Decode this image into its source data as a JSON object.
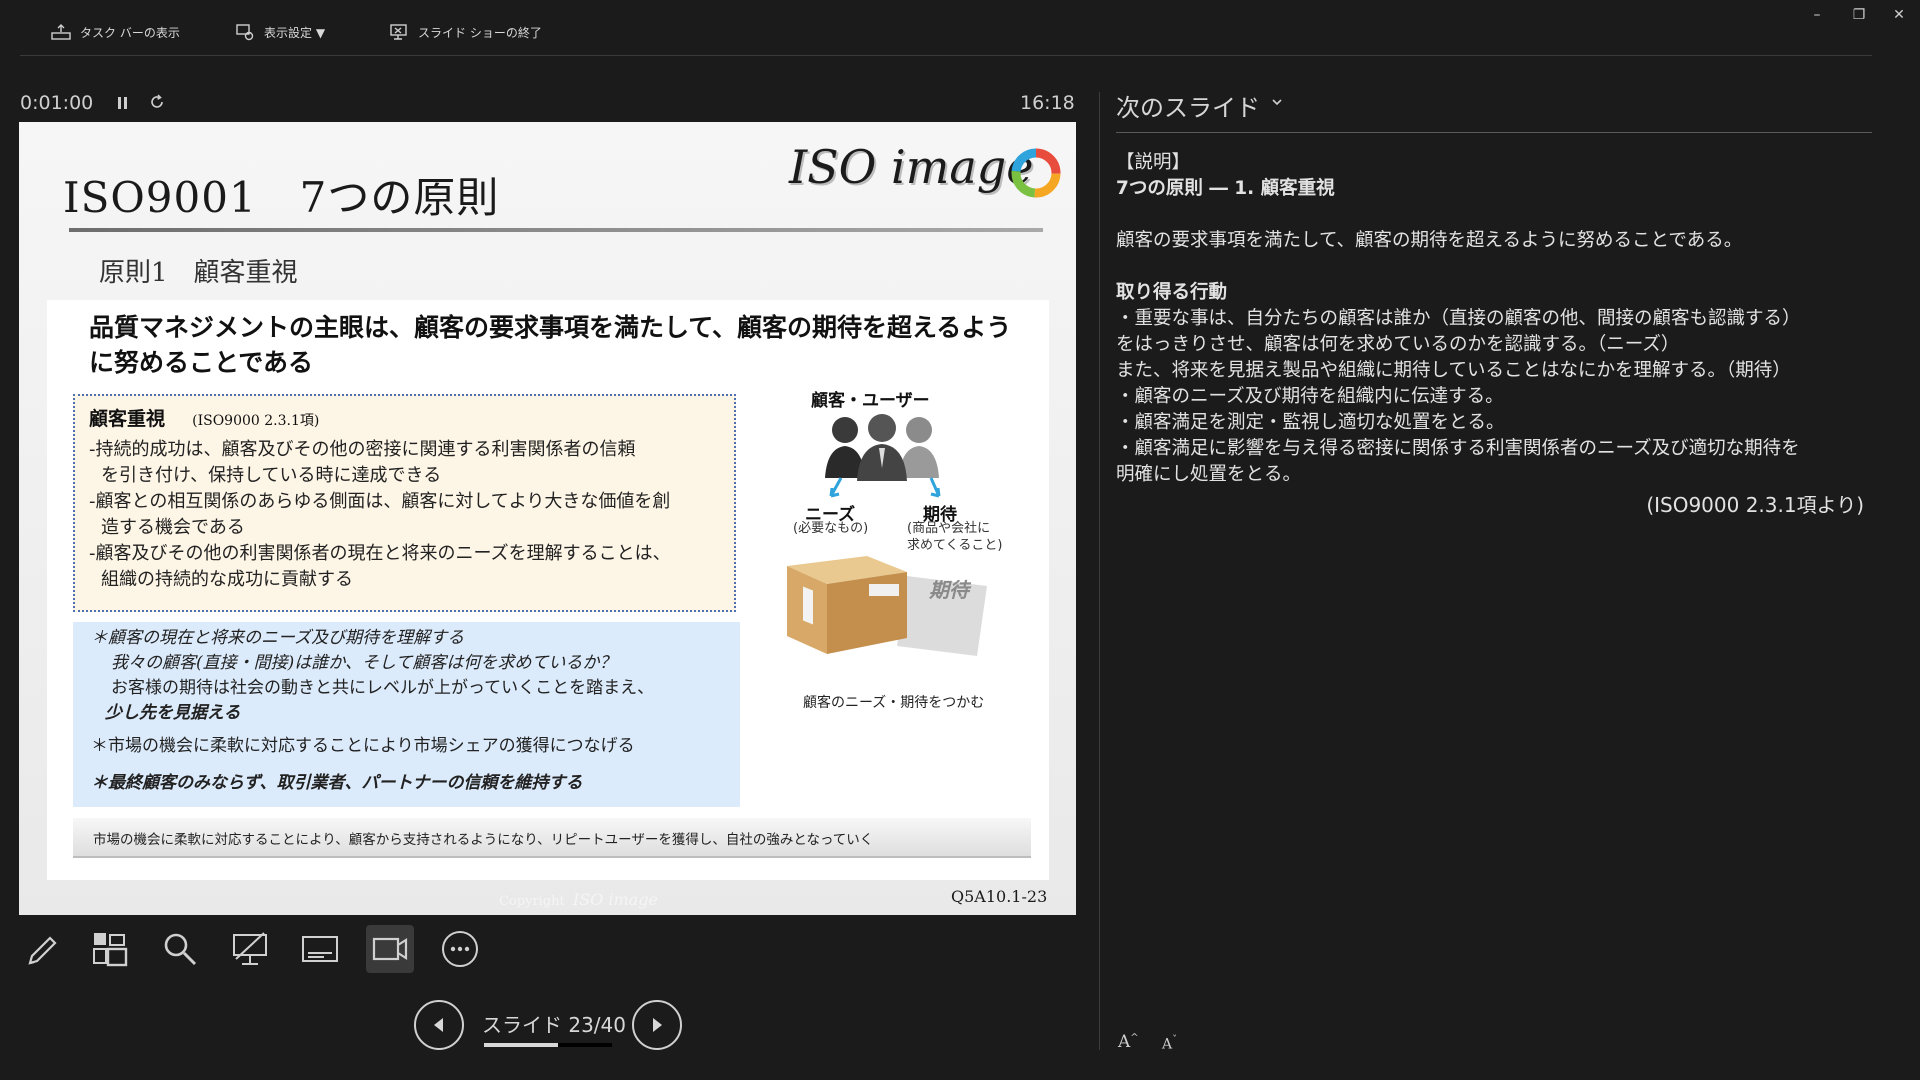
{
  "topbar": {
    "taskbar_label": "タスク バーの表示",
    "display_settings_label": "表示設定 ▼",
    "end_show_label": "スライド ショーの終了"
  },
  "presenter": {
    "timer": "0:01:00",
    "clock": "16:18"
  },
  "slide": {
    "title": "ISO9001　7つの原則",
    "logo_text": "ISO image",
    "subtitle": "原則1　顧客重視",
    "headline": "品質マネジメントの主眼は、顧客の要求事項を満たして、顧客の期待を超えるように努めることである",
    "yellow_box": {
      "title": "顧客重視",
      "ref": "(ISO9000 2.3.1項)",
      "lines": [
        "-持続的成功は、顧客及びその他の密接に関連する利害関係者の信頼",
        "を引き付け、保持している時に達成できる",
        "-顧客との相互関係のあらゆる側面は、顧客に対してより大きな価値を創",
        "造する機会である",
        "-顧客及びその他の利害関係者の現在と将来のニーズを理解することは、",
        "組織の持続的な成功に貢献する"
      ]
    },
    "blue_box": {
      "lines": [
        "＊顧客の現在と将来のニーズ及び期待を理解する",
        "我々の顧客(直接・間接)は誰か、そして顧客は何を求めているか？",
        "お客様の期待は社会の動きと共にレベルが上がっていくことを踏まえ、",
        "少し先を見据える",
        "＊市場の機会に柔軟に対応することにより市場シェアの獲得につなげる",
        "＊最終顧客のみならず、取引業者、パートナーの信頼を維持する"
      ]
    },
    "footer_strip": "市場の機会に柔軟に対応することにより、顧客から支持されるようになり、リピートユーザーを獲得し、自社の強みとなっていく",
    "illustration": {
      "users_label": "顧客・ユーザー",
      "needs_label": "ニーズ",
      "needs_sub": "(必要なもの)",
      "expect_label": "期待",
      "expect_sub1": "(商品や会社に",
      "expect_sub2": "求めてくること)",
      "box_label": "期待",
      "caption": "顧客のニーズ・期待をつかむ"
    },
    "copyright_prefix": "Copyright",
    "copyright_logo": "ISO image",
    "code": "Q5A10.1-23"
  },
  "navigation": {
    "slide_counter": "スライド 23/40",
    "progress": 0.575
  },
  "notes_pane": {
    "next_slide_label": "次のスライド",
    "lines": {
      "l1": "【説明】",
      "l2": "7つの原則 ― 1. 顧客重視",
      "l3": "顧客の要求事項を満たして、顧客の期待を超えるように努めることである。",
      "l4": "取り得る行動",
      "l5": "・重要な事は、自分たちの顧客は誰か（直接の顧客の他、間接の顧客も認識する）",
      "l6": "をはっきりさせ、顧客は何を求めているのかを認識する。（ニーズ）",
      "l7": "また、将来を見据え製品や組織に期待していることはなにかを理解する。（期待）",
      "l8": "・顧客のニーズ及び期待を組織内に伝達する。",
      "l9": "・顧客満足を測定・監視し適切な処置をとる。",
      "l10": "・顧客満足に影響を与え得る密接に関係する利害関係者のニーズ及び適切な期待を",
      "l11": "明確にし処置をとる。",
      "l12": "(ISO9000 2.3.1項より)"
    },
    "font_up": "A",
    "font_down": "A"
  },
  "colors": {
    "background": "#1b1b1b",
    "yellow_box": "#fdf5e6",
    "blue_box": "#dcebfb",
    "dotted_border": "#4f6fb3"
  }
}
